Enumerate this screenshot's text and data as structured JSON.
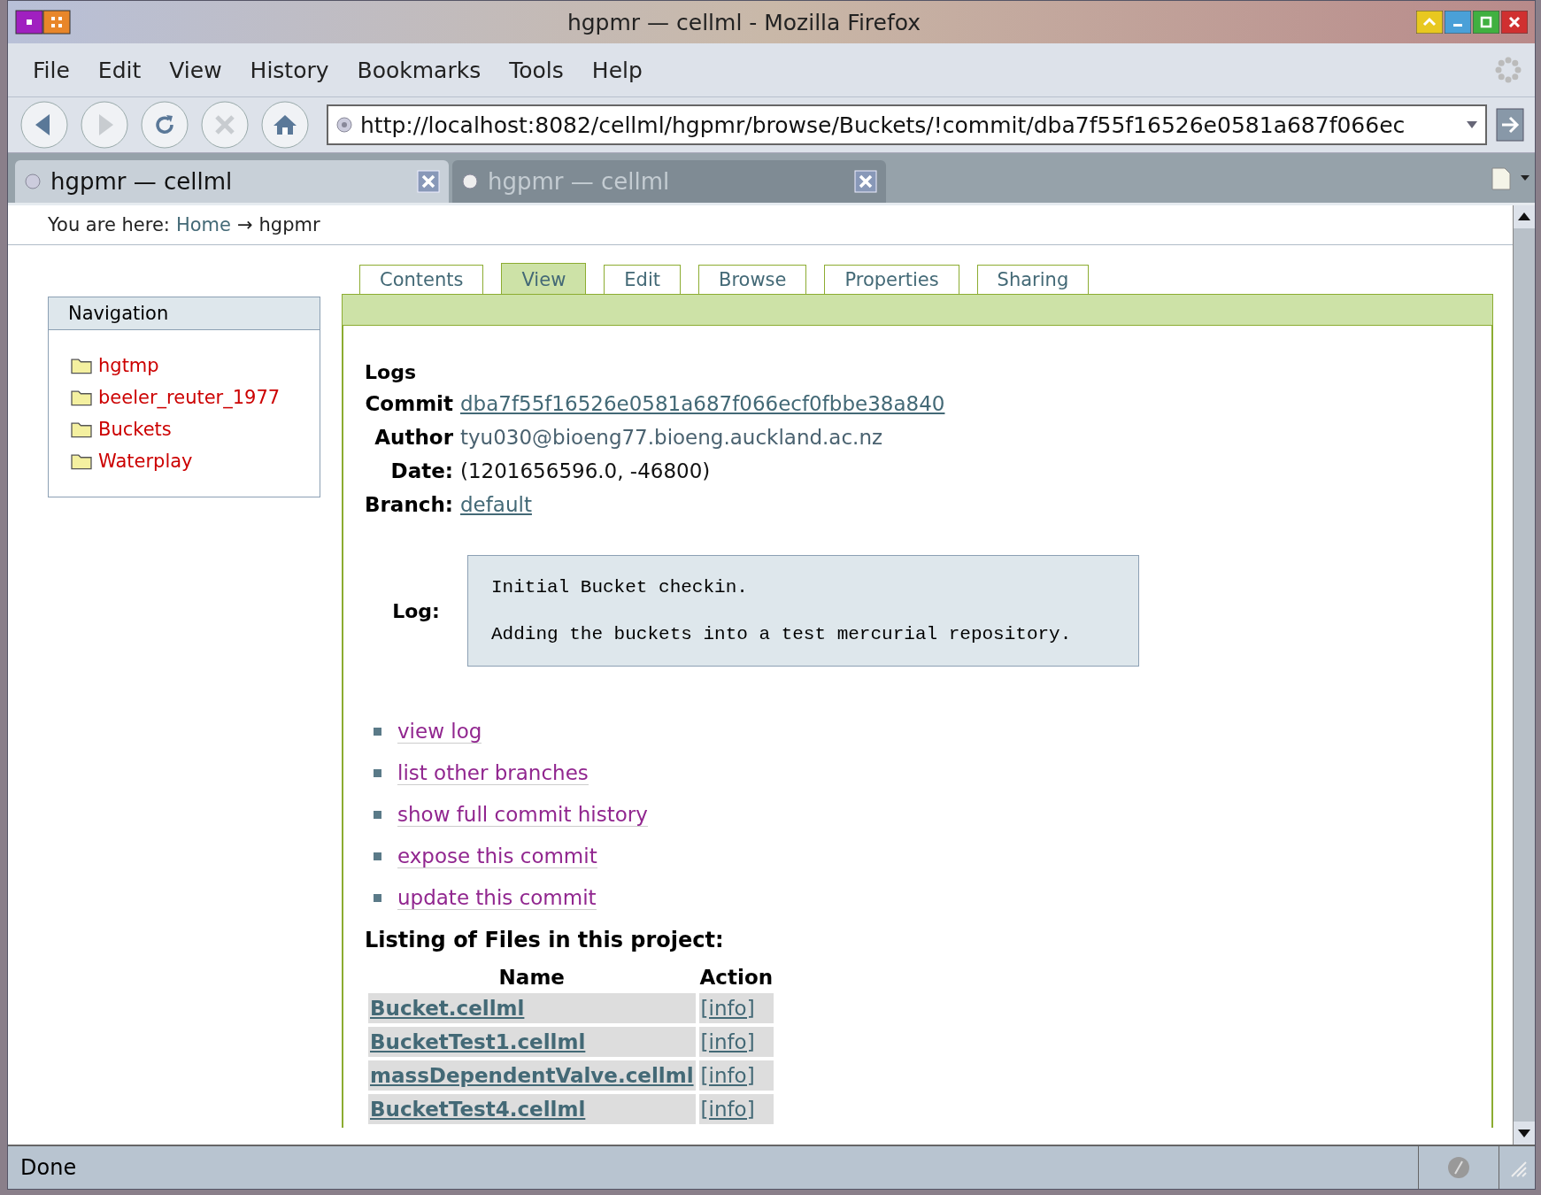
{
  "window": {
    "title": "hgpmr — cellml - Mozilla Firefox"
  },
  "menu": [
    "File",
    "Edit",
    "View",
    "History",
    "Bookmarks",
    "Tools",
    "Help"
  ],
  "url": "http://localhost:8082/cellml/hgpmr/browse/Buckets/!commit/dba7f55f16526e0581a687f066ec",
  "browser_tabs": [
    {
      "title": "hgpmr — cellml",
      "selected": true
    },
    {
      "title": "hgpmr — cellml",
      "selected": false
    }
  ],
  "breadcrumb": {
    "label": "You are here:",
    "home": "Home",
    "arrow": "→",
    "current": "hgpmr"
  },
  "navigation": {
    "title": "Navigation",
    "items": [
      "hgtmp",
      "beeler_reuter_1977",
      "Buckets",
      "Waterplay"
    ]
  },
  "tabs": [
    {
      "label": "Contents",
      "selected": false
    },
    {
      "label": "View",
      "selected": true
    },
    {
      "label": "Edit",
      "selected": false
    },
    {
      "label": "Browse",
      "selected": false
    },
    {
      "label": "Properties",
      "selected": false
    },
    {
      "label": "Sharing",
      "selected": false
    }
  ],
  "logs": {
    "heading": "Logs",
    "fields": [
      {
        "label": "Commit",
        "value": "dba7f55f16526e0581a687f066ecf0fbbe38a840",
        "kind": "link"
      },
      {
        "label": "Author",
        "value": "tyu030@bioeng77.bioeng.auckland.ac.nz",
        "kind": "muted"
      },
      {
        "label": "Date:",
        "value": "(1201656596.0, -46800)",
        "kind": "plain"
      },
      {
        "label": "Branch:",
        "value": "default",
        "kind": "link"
      }
    ],
    "log_label": "Log:",
    "log_lines": [
      "Initial Bucket checkin.",
      "Adding the buckets into a test mercurial repository."
    ]
  },
  "actions": [
    "view log",
    "list other branches",
    "show full commit history",
    "expose this commit",
    "update this commit"
  ],
  "files": {
    "heading": "Listing of Files in this project:",
    "columns": [
      "Name",
      "Action"
    ],
    "rows": [
      {
        "name": "Bucket.cellml",
        "action": "[info]"
      },
      {
        "name": "BucketTest1.cellml",
        "action": "[info]"
      },
      {
        "name": "massDependentValve.cellml",
        "action": "[info]"
      },
      {
        "name": "BucketTest4.cellml",
        "action": "[info]"
      }
    ]
  },
  "status_bar": {
    "text": "Done"
  }
}
